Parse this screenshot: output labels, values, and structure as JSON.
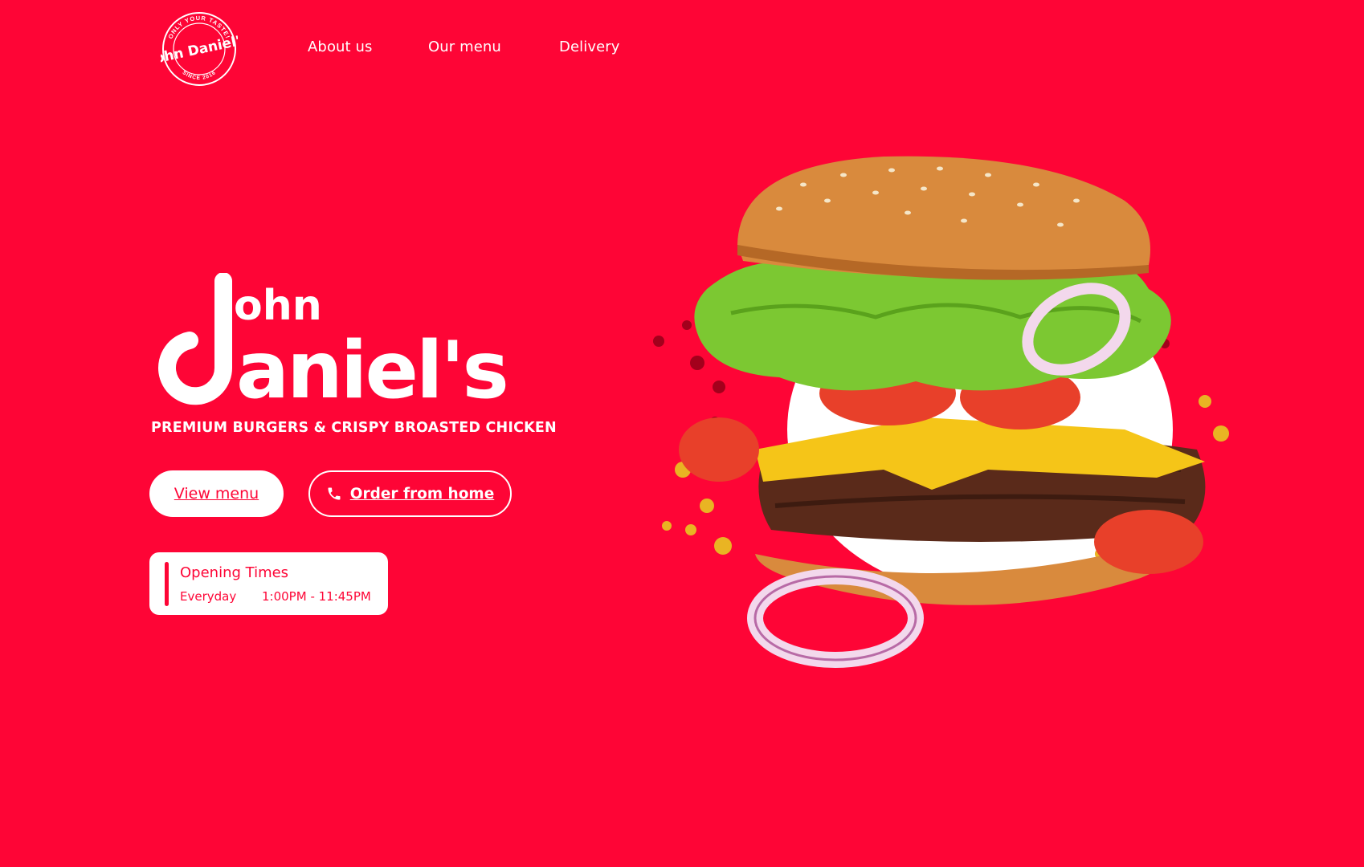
{
  "logo": {
    "alt": "John Daniel's",
    "ring_top": "ONLY YOUR TASTE!",
    "ring_bottom": "SINCE 2016",
    "script": "John Daniel's"
  },
  "nav": {
    "items": [
      {
        "label": "About us"
      },
      {
        "label": "Our menu"
      },
      {
        "label": "Delivery"
      }
    ]
  },
  "hero": {
    "brand_line1": "ohn",
    "brand_line2": "aniel's",
    "tagline": "PREMIUM BURGERS & CRISPY BROASTED CHICKEN",
    "buttons": {
      "view_menu": "View menu",
      "order_home": "Order from home"
    },
    "opening": {
      "title": "Opening Times",
      "day": "Everyday",
      "time": "1:00PM - 11:45PM"
    }
  },
  "colors": {
    "background": "#fe0536",
    "accent": "#fe0536",
    "text_on_red": "#ffffff"
  },
  "icons": {
    "phone": "phone-icon"
  }
}
